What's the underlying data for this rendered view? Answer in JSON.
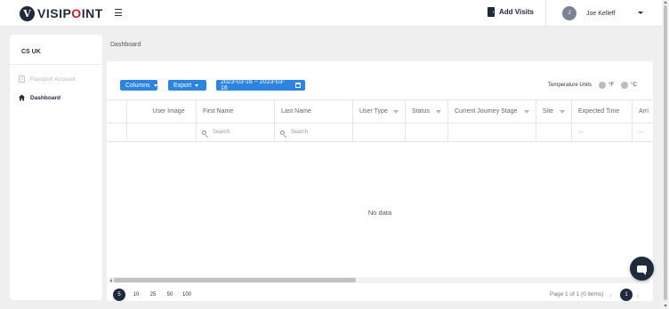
{
  "app": {
    "logo_mark": "V",
    "logo_prefix": "VISIP",
    "logo_accent": "O",
    "logo_suffix": "INT"
  },
  "header": {
    "add_visits_label": "Add Visits",
    "user_initial": "J",
    "user_name": "Joe Kelleff"
  },
  "sidebar": {
    "org_name": "CS UK",
    "items": [
      {
        "label": "Passport Account",
        "icon": "passport-icon",
        "active": false
      },
      {
        "label": "Dashboard",
        "icon": "home-icon",
        "active": true
      }
    ]
  },
  "breadcrumb": "Dashboard",
  "toolbar": {
    "columns_label": "Columns",
    "export_label": "Export",
    "date_range": "2023-03-16 ~ 2023-03-16",
    "temperature_label": "Temperature Units",
    "unit_f": "°F",
    "unit_c": "°C"
  },
  "table": {
    "columns": [
      "",
      "User Image",
      "First Name",
      "Last Name",
      "User Type",
      "Status",
      "Current Journey Stage",
      "Site",
      "Expected Time",
      "Arri"
    ],
    "search_placeholder": "Search",
    "empty_dash": "---",
    "no_data": "No data"
  },
  "pagination": {
    "sizes": [
      "5",
      "10",
      "25",
      "50",
      "100"
    ],
    "selected_size": "5",
    "info": "Page 1 of 1 (0 items)",
    "current_page": "1",
    "prev": "‹",
    "next": "›"
  },
  "colors": {
    "brand_dark": "#1f2a3c",
    "brand_accent": "#c21f2d",
    "button_blue": "#2d83e0"
  }
}
